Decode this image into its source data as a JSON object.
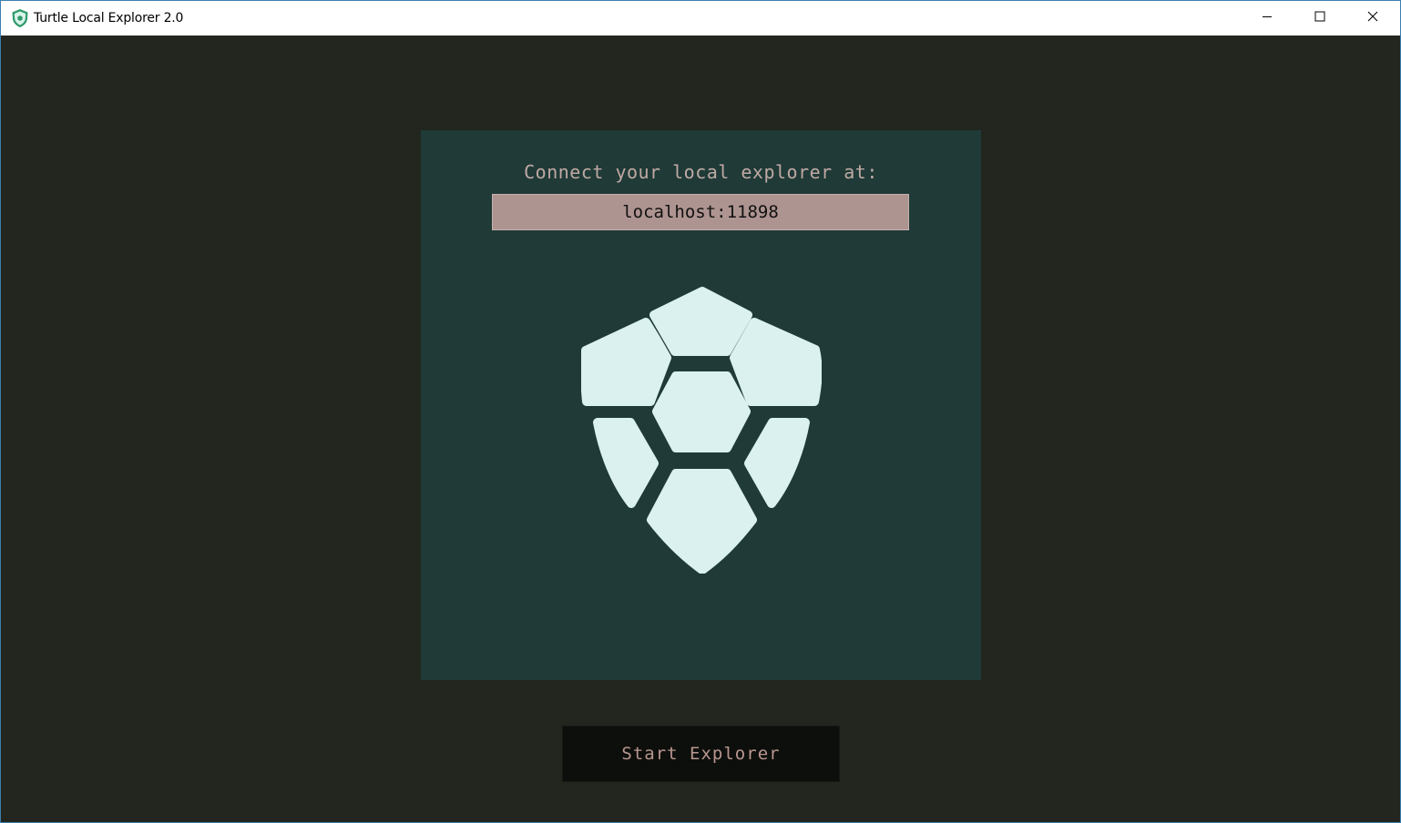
{
  "window": {
    "title": "Turtle Local Explorer 2.0",
    "icon": "turtle-shield-icon",
    "controls": {
      "minimize": "minimize-icon",
      "maximize": "maximize-icon",
      "close": "close-icon"
    }
  },
  "panel": {
    "connect_label": "Connect your local explorer at:",
    "address": "localhost:11898",
    "logo": "turtle-shell-logo"
  },
  "actions": {
    "start_label": "Start Explorer"
  },
  "colors": {
    "background": "#22261f",
    "panel": "#1f3a37",
    "address_box": "#ae9491",
    "label_text": "#c0a9a4",
    "logo": "#daf1f0",
    "button_bg": "#0d0f0c",
    "button_text": "#b99690"
  }
}
